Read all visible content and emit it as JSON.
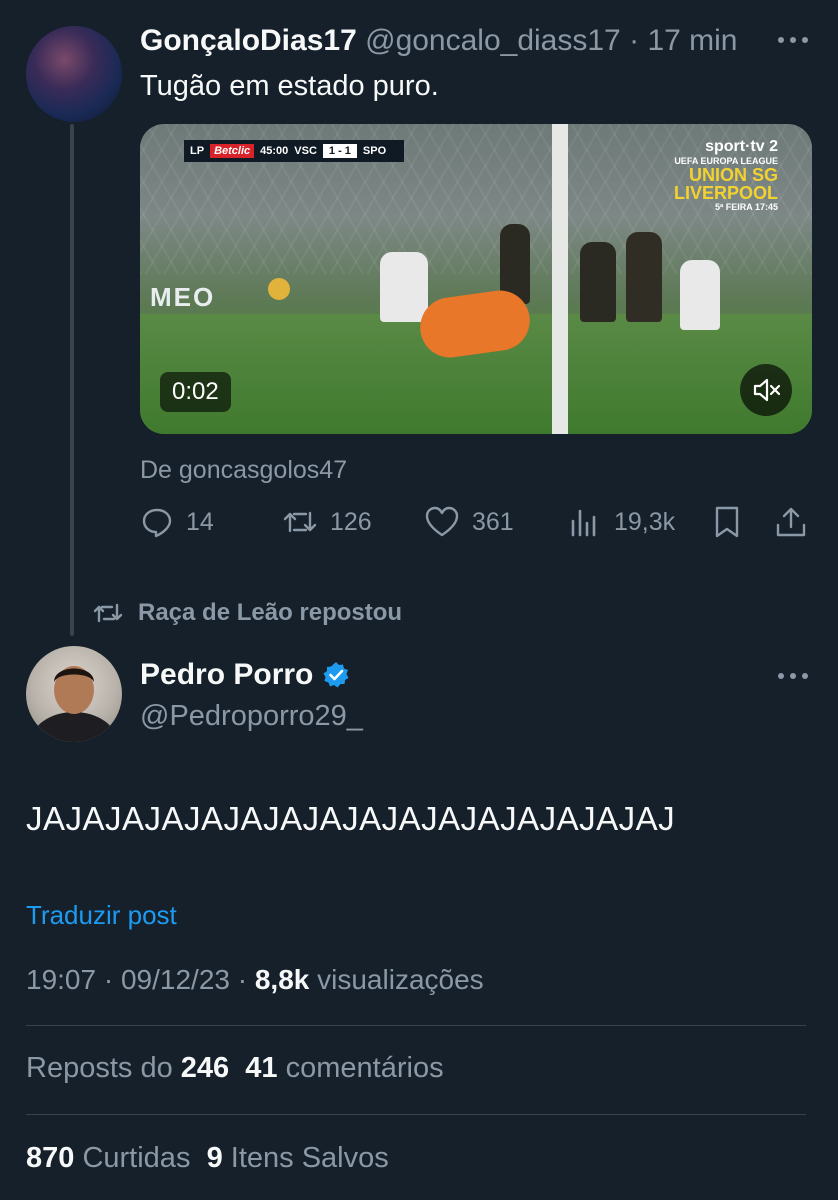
{
  "tweet1": {
    "author_name": "GonçaloDias17",
    "author_handle": "@goncalo_diass17",
    "separator": "·",
    "time": "17 min",
    "text": "Tugão em estado puro.",
    "video": {
      "duration": "0:02",
      "scorebug_league": "LP",
      "scorebug_sponsor": "Betclic",
      "scorebug_clock": "45:00",
      "scorebug_home": "VSC",
      "scorebug_score": "1 - 1",
      "scorebug_away": "SPO",
      "broadcaster": "sport·tv 2",
      "competition": "UEFA EUROPA LEAGUE",
      "promo_team1": "UNION SG",
      "promo_team2": "LIVERPOOL",
      "promo_when": "5ª FEIRA 17:45",
      "board_text": "MEO"
    },
    "source": "De goncasgolos47",
    "actions": {
      "replies": "14",
      "reposts": "126",
      "likes": "361",
      "views": "19,3k"
    }
  },
  "repost_indicator": "Raça de Leão repostou",
  "tweet2": {
    "author_name": "Pedro Porro",
    "author_handle": "@Pedroporro29_",
    "verified": true,
    "text": "JAJAJAJAJAJAJAJAJAJAJAJAJAJAJAJAJ",
    "translate": "Traduzir post",
    "time": "19:07",
    "dot": "·",
    "date": "09/12/23",
    "views_count": "8,8k",
    "views_label": "visualizações",
    "reposts_label": "Reposts do",
    "reposts_count": "246",
    "comments_count": "41",
    "comments_label": "comentários",
    "likes_count": "870",
    "likes_label": "Curtidas",
    "saves_count": "9",
    "saves_label": "Itens Salvos"
  },
  "colors": {
    "background": "#15202b",
    "text": "#f7f9f9",
    "muted": "#8b98a5",
    "accent": "#1d9bf0",
    "divider": "#38444d"
  },
  "icons": [
    "more-icon",
    "reply-icon",
    "repost-icon",
    "like-icon",
    "views-icon",
    "bookmark-icon",
    "share-icon",
    "mute-icon",
    "verified-badge-icon"
  ]
}
